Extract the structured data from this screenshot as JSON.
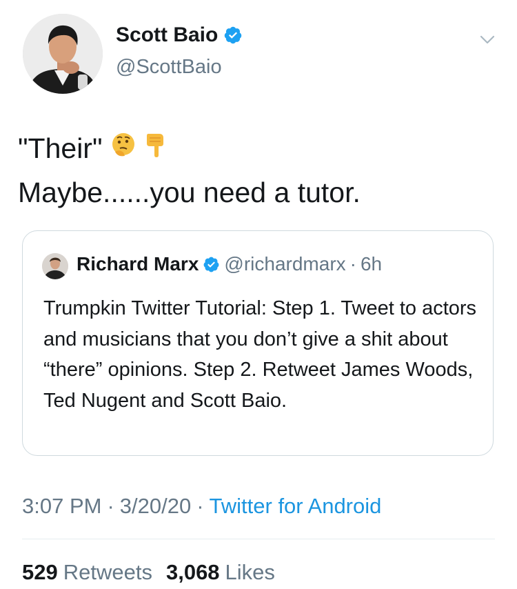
{
  "tweet": {
    "author": {
      "display_name": "Scott Baio",
      "handle": "@ScottBaio",
      "verified": true,
      "avatar_icon": "author-avatar"
    },
    "text_line1": "\"Their\"",
    "text_line1_emojis": [
      "thinking-face-emoji",
      "pointing-down-emoji"
    ],
    "text_line2": "Maybe......you need a tutor.",
    "quoted": {
      "author": {
        "display_name": "Richard Marx",
        "handle": "@richardmarx",
        "verified": true
      },
      "separator": "·",
      "age": "6h",
      "text": "Trumpkin Twitter Tutorial: Step 1. Tweet to actors and musicians that you don’t give a shit about “there” opinions. Step 2. Retweet James Woods, Ted Nugent and Scott Baio."
    },
    "time": "3:07 PM",
    "date": "3/20/20",
    "source": "Twitter for Android",
    "sep": "·",
    "retweets_count": "529",
    "retweets_label": "Retweets",
    "likes_count": "3,068",
    "likes_label": "Likes"
  },
  "colors": {
    "verified": "#1da1f2",
    "link": "#1b95e0",
    "muted": "#657786",
    "border": "#cfd9de"
  }
}
